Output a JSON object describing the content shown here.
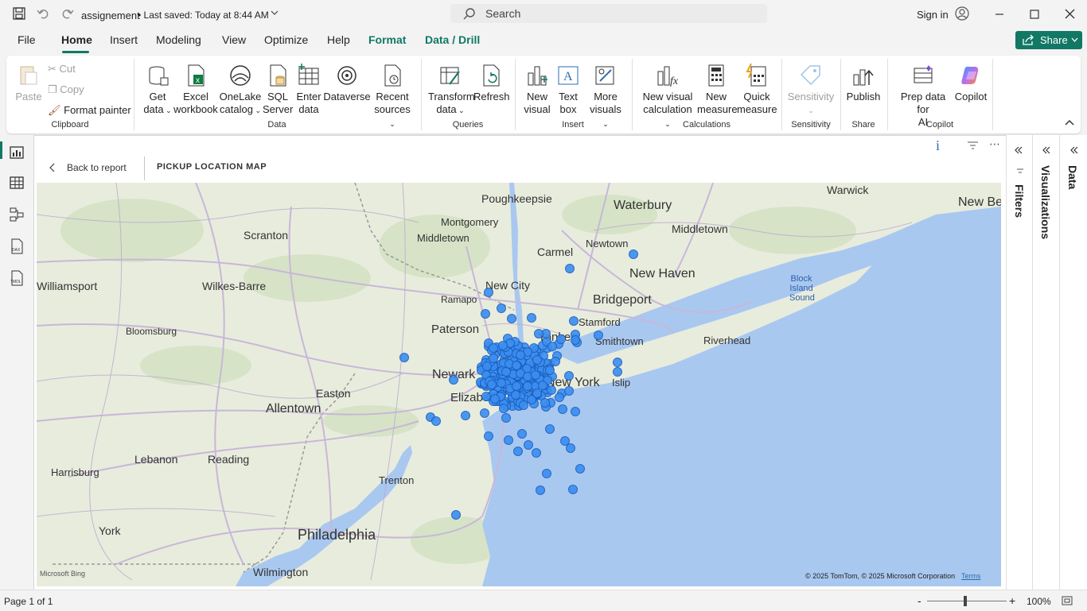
{
  "titlebar": {
    "filename": "assignement",
    "saved_status": "• Last saved: Today at 8:44 AM",
    "search_placeholder": "Search",
    "signin": "Sign in"
  },
  "menu": {
    "file": "File",
    "home": "Home",
    "insert": "Insert",
    "modeling": "Modeling",
    "view": "View",
    "optimize": "Optimize",
    "help": "Help",
    "format": "Format",
    "data_drill": "Data / Drill",
    "share": "Share"
  },
  "ribbon": {
    "clipboard": {
      "paste": "Paste",
      "cut": "Cut",
      "copy": "Copy",
      "format_painter": "Format painter",
      "label": "Clipboard"
    },
    "data": {
      "get_data": [
        "Get",
        "data"
      ],
      "excel": [
        "Excel",
        "workbook"
      ],
      "onelake": [
        "OneLake",
        "catalog"
      ],
      "sql": [
        "SQL",
        "Server"
      ],
      "enter": [
        "Enter",
        "data"
      ],
      "dataverse": "Dataverse",
      "recent": [
        "Recent",
        "sources"
      ],
      "label": "Data"
    },
    "queries": {
      "transform": [
        "Transform",
        "data"
      ],
      "refresh": "Refresh",
      "label": "Queries"
    },
    "insert": {
      "new_visual": [
        "New",
        "visual"
      ],
      "text_box": [
        "Text",
        "box"
      ],
      "more_visuals": [
        "More",
        "visuals"
      ],
      "label": "Insert"
    },
    "calculations": {
      "new_visual_calc": [
        "New visual",
        "calculation"
      ],
      "new_measure": [
        "New",
        "measure"
      ],
      "quick_measure": [
        "Quick",
        "measure"
      ],
      "label": "Calculations"
    },
    "sensitivity": {
      "sensitivity": "Sensitivity",
      "label": "Sensitivity"
    },
    "share": {
      "publish": "Publish",
      "label": "Share"
    },
    "copilot": {
      "prep": [
        "Prep data for",
        "AI"
      ],
      "copilot": "Copilot",
      "label": "Copilot"
    }
  },
  "canvas": {
    "back": "Back to report",
    "visual_title": "PICKUP LOCATION MAP",
    "attribution": "© 2025 TomTom, © 2025 Microsoft Corporation",
    "terms": "Terms",
    "bing": "Microsoft Bing"
  },
  "map_labels": [
    {
      "text": "Poughkeepsie"
    },
    {
      "text": "Waterbury"
    },
    {
      "text": "Warwick"
    },
    {
      "text": "New Be"
    },
    {
      "text": "Scranton"
    },
    {
      "text": "Montgomery"
    },
    {
      "text": "Middletown"
    },
    {
      "text": "Middletown"
    },
    {
      "text": "Newtown"
    },
    {
      "text": "Carmel"
    },
    {
      "text": "New Haven"
    },
    {
      "text": "Williamsport"
    },
    {
      "text": "Wilkes-Barre"
    },
    {
      "text": "New City"
    },
    {
      "text": "Ramapo"
    },
    {
      "text": "Bridgeport"
    },
    {
      "text": "Block Island Sound"
    },
    {
      "text": "Stamford"
    },
    {
      "text": "Bloomsburg"
    },
    {
      "text": "Paterson"
    },
    {
      "text": "Yonkers"
    },
    {
      "text": "Smithtown"
    },
    {
      "text": "Riverhead"
    },
    {
      "text": "Newark"
    },
    {
      "text": "New York"
    },
    {
      "text": "Islip"
    },
    {
      "text": "Elizabeth"
    },
    {
      "text": "Easton"
    },
    {
      "text": "Allentown"
    },
    {
      "text": "Lebanon"
    },
    {
      "text": "Reading"
    },
    {
      "text": "Harrisburg"
    },
    {
      "text": "Trenton"
    },
    {
      "text": "York"
    },
    {
      "text": "Philadelphia"
    },
    {
      "text": "Wilmington"
    }
  ],
  "panes": {
    "filters": "Filters",
    "visualizations": "Visualizations",
    "data": "Data"
  },
  "status": {
    "page": "Page 1 of 1",
    "zoom": "100%",
    "minus": "-",
    "plus": "+"
  },
  "colors": {
    "accent": "#117865",
    "dots": "#3b8ef0",
    "water": "#a9c8f0",
    "land": "#e9ecdf"
  }
}
